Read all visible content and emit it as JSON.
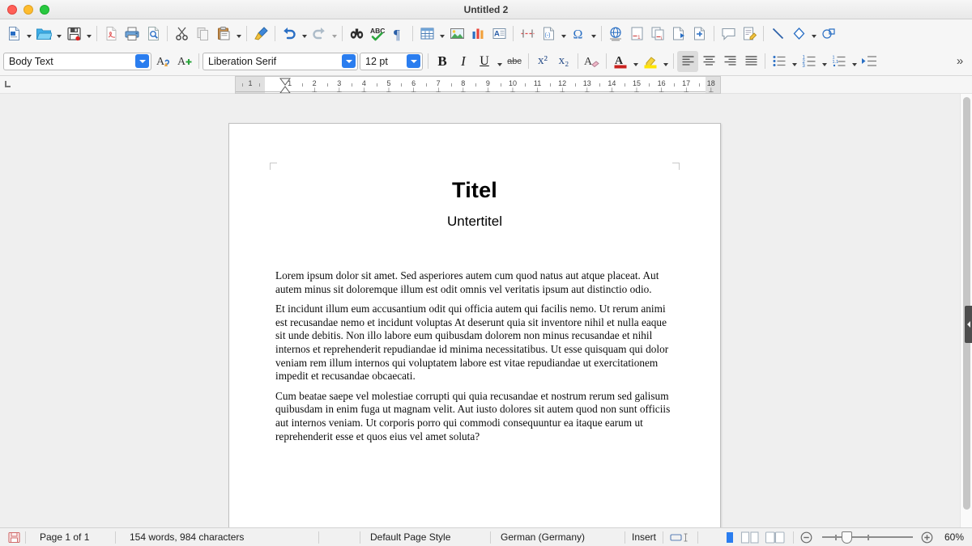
{
  "window": {
    "title": "Untitled 2",
    "controls": [
      {
        "name": "close",
        "color": "#ff5f57"
      },
      {
        "name": "minimize",
        "color": "#febc2e"
      },
      {
        "name": "maximize",
        "color": "#28c840"
      }
    ]
  },
  "main_toolbar": {
    "items": [
      {
        "icon": "new-document-icon",
        "label": "New",
        "dropdown": true
      },
      {
        "icon": "open-folder-icon",
        "label": "Open",
        "dropdown": true
      },
      {
        "icon": "save-icon",
        "label": "Save",
        "dropdown": true
      },
      {
        "sep": true
      },
      {
        "icon": "export-pdf-icon",
        "label": "Export as PDF"
      },
      {
        "icon": "print-icon",
        "label": "Print"
      },
      {
        "icon": "print-preview-icon",
        "label": "Toggle Print Preview"
      },
      {
        "sep": true
      },
      {
        "icon": "cut-icon",
        "label": "Cut"
      },
      {
        "icon": "copy-icon",
        "label": "Copy"
      },
      {
        "icon": "paste-icon",
        "label": "Paste",
        "dropdown": true
      },
      {
        "sep": true
      },
      {
        "icon": "clone-formatting-icon",
        "label": "Clone Formatting"
      },
      {
        "sep": true
      },
      {
        "icon": "undo-icon",
        "label": "Undo",
        "dropdown": true
      },
      {
        "icon": "redo-icon",
        "label": "Redo",
        "dropdown": true
      },
      {
        "sep": true
      },
      {
        "icon": "find-replace-icon",
        "label": "Find and Replace"
      },
      {
        "icon": "spelling-icon",
        "label": "Check Spelling"
      },
      {
        "icon": "formatting-marks-icon",
        "label": "Formatting Marks"
      },
      {
        "sep": true
      },
      {
        "icon": "insert-table-icon",
        "label": "Insert Table",
        "dropdown": true
      },
      {
        "icon": "insert-image-icon",
        "label": "Insert Image"
      },
      {
        "icon": "insert-chart-icon",
        "label": "Insert Chart"
      },
      {
        "icon": "insert-textbox-icon",
        "label": "Insert Text Box"
      },
      {
        "sep": true
      },
      {
        "icon": "page-break-icon",
        "label": "Insert Page Break"
      },
      {
        "icon": "insert-field-icon",
        "label": "Insert Field",
        "dropdown": true
      },
      {
        "icon": "special-character-icon",
        "label": "Insert Special Character",
        "dropdown": true
      },
      {
        "sep": true
      },
      {
        "icon": "hyperlink-icon",
        "label": "Insert Hyperlink"
      },
      {
        "icon": "footnote-icon",
        "label": "Insert Footnote"
      },
      {
        "icon": "endnote-icon",
        "label": "Insert Endnote"
      },
      {
        "icon": "bookmark-icon",
        "label": "Insert Bookmark"
      },
      {
        "icon": "cross-reference-icon",
        "label": "Insert Cross-reference"
      },
      {
        "sep": true
      },
      {
        "icon": "comment-icon",
        "label": "Insert Comment"
      },
      {
        "icon": "track-changes-icon",
        "label": "Track Changes"
      },
      {
        "sep": true
      },
      {
        "icon": "line-icon",
        "label": "Insert Line"
      },
      {
        "icon": "basic-shapes-icon",
        "label": "Basic Shapes",
        "dropdown": true
      },
      {
        "icon": "show-draw-functions-icon",
        "label": "Show Draw Functions"
      }
    ]
  },
  "format_toolbar": {
    "paragraph_style": {
      "value": "Body Text",
      "placeholder": "Paragraph Style"
    },
    "font_name": {
      "value": "Liberation Serif",
      "placeholder": "Font Name"
    },
    "font_size": {
      "value": "12 pt",
      "placeholder": "Font Size"
    },
    "update_style_label": "Update Selected Style",
    "new_style_label": "New Style from Selection",
    "buttons": [
      {
        "icon": "bold-icon",
        "label": "Bold",
        "glyph": "B"
      },
      {
        "icon": "italic-icon",
        "label": "Italic",
        "glyph": "I"
      },
      {
        "icon": "underline-icon",
        "label": "Underline",
        "glyph": "U",
        "dropdown": true
      },
      {
        "icon": "strikethrough-icon",
        "label": "Strikethrough",
        "glyph": "abc"
      },
      {
        "icon": "superscript-icon",
        "label": "Superscript",
        "glyph": "x²"
      },
      {
        "icon": "subscript-icon",
        "label": "Subscript",
        "glyph": "x₂"
      },
      {
        "icon": "clear-formatting-icon",
        "label": "Clear Direct Formatting"
      },
      {
        "icon": "font-color-icon",
        "label": "Font Color",
        "dropdown": true
      },
      {
        "icon": "highlight-color-icon",
        "label": "Character Highlighting Color",
        "dropdown": true
      },
      {
        "icon": "align-left-icon",
        "label": "Align Left",
        "active": true
      },
      {
        "icon": "align-center-icon",
        "label": "Align Center"
      },
      {
        "icon": "align-right-icon",
        "label": "Align Right"
      },
      {
        "icon": "justified-icon",
        "label": "Justified"
      },
      {
        "icon": "unordered-list-icon",
        "label": "Unordered List",
        "dropdown": true
      },
      {
        "icon": "ordered-list-icon",
        "label": "Ordered List",
        "dropdown": true
      },
      {
        "icon": "outline-format-icon",
        "label": "Outline Format",
        "dropdown": true
      },
      {
        "icon": "increase-indent-icon",
        "label": "Increase Indent"
      }
    ],
    "overflow_label": "»"
  },
  "ruler": {
    "left_marker_label": "1",
    "ticks": [
      "1",
      "2",
      "3",
      "4",
      "5",
      "6",
      "7",
      "8",
      "9",
      "10",
      "11",
      "12",
      "13",
      "14",
      "15",
      "16",
      "17",
      "18"
    ],
    "unit": "inch"
  },
  "document": {
    "title": "Titel",
    "subtitle": "Untertitel",
    "paragraphs": [
      "Lorem ipsum dolor sit amet. Sed asperiores autem cum quod natus aut atque placeat. Aut autem minus sit doloremque illum est odit omnis vel veritatis ipsum aut distinctio odio.",
      "Et incidunt illum eum accusantium odit qui officia autem qui facilis nemo. Ut rerum animi est recusandae nemo et incidunt voluptas At deserunt quia sit inventore nihil et nulla eaque sit unde debitis. Non illo labore eum quibusdam dolorem non minus recusandae et nihil internos et reprehenderit repudiandae id minima necessitatibus. Ut esse quisquam qui dolor veniam rem illum internos qui voluptatem labore est vitae repudiandae ut exercitationem impedit et recusandae obcaecati.",
      "Cum beatae saepe vel molestiae corrupti qui quia recusandae et nostrum rerum sed galisum quibusdam in enim fuga ut magnam velit. Aut iusto dolores sit autem quod non sunt officiis aut internos veniam. Ut corporis porro qui commodi consequuntur ea itaque earum ut reprehenderit esse et quos eius vel amet soluta?"
    ]
  },
  "statusbar": {
    "save_status_icon": "save-status-icon",
    "page_info": "Page 1 of 1",
    "word_count": "154 words, 984 characters",
    "page_style": "Default Page Style",
    "language": "German (Germany)",
    "insert_mode": "Insert",
    "selection_mode_icon": "selection-mode-icon",
    "view_single_page_icon": "single-page-view-icon",
    "view_multi_page_icon": "multi-page-view-icon",
    "view_book_icon": "book-view-icon",
    "zoom_out_label": "−",
    "zoom_in_label": "+",
    "zoom_level": "60%"
  },
  "colors": {
    "accent_blue": "#2a7def",
    "toolbar_bg": "#f6f6f6",
    "workarea_bg": "#efefef",
    "page_bg": "#ffffff"
  }
}
